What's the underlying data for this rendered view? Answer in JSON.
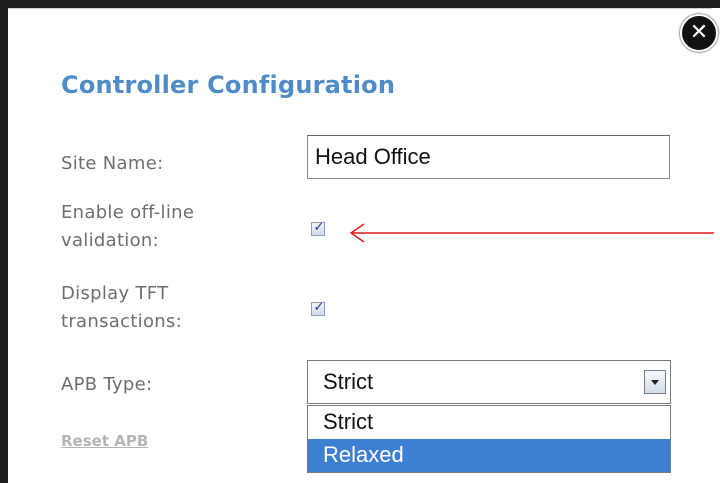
{
  "dialog": {
    "title": "Controller Configuration",
    "close_label": "✕"
  },
  "form": {
    "site_name_label": "Site Name:",
    "site_name_value": "Head Office",
    "offline_label": "Enable off-line validation:",
    "offline_checked": true,
    "tft_label": "Display TFT transactions:",
    "tft_checked": true,
    "apb_type_label": "APB Type:",
    "apb_type_selected": "Strict",
    "apb_type_options": [
      "Strict",
      "Relaxed"
    ],
    "apb_type_highlighted": "Relaxed",
    "reset_apb_label": "Reset APB"
  },
  "icons": {
    "close": "close-icon",
    "checkmark": "checkmark-icon",
    "dropdown": "chevron-down-icon",
    "annotation_arrow": "arrow-left-icon"
  },
  "colors": {
    "title": "#4f8cc7",
    "highlight": "#3d7fd1",
    "annotation_arrow": "#e01818",
    "disabled_link": "#b5b5b5"
  }
}
